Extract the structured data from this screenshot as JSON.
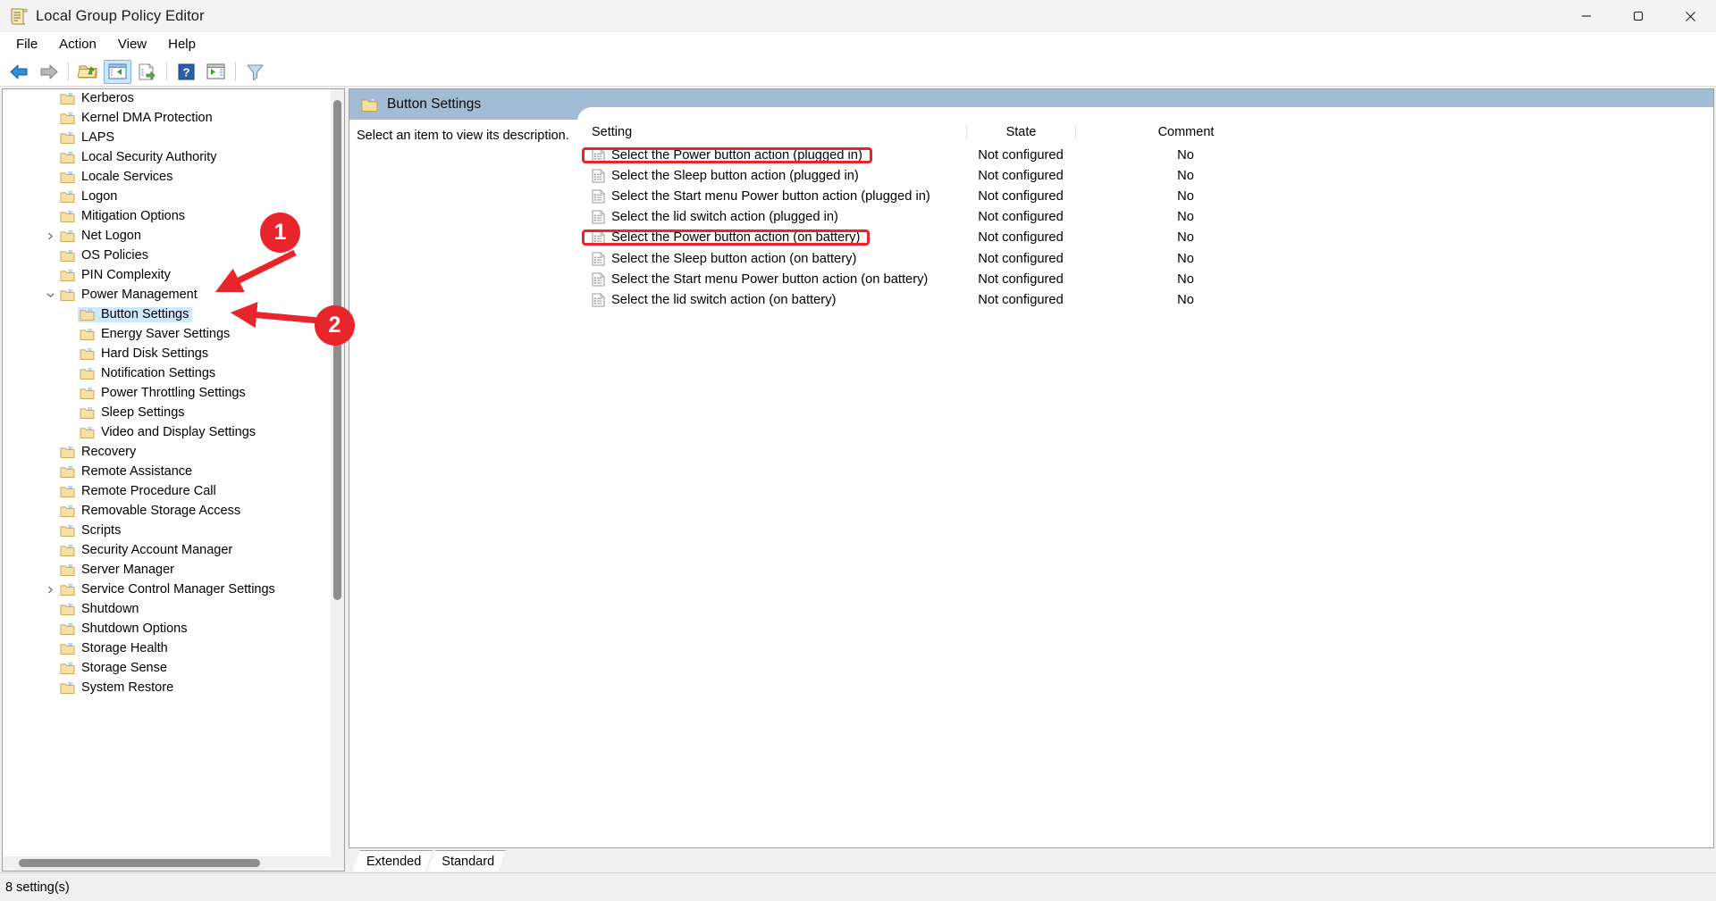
{
  "window": {
    "title": "Local Group Policy Editor",
    "icon": "group-policy-document-icon",
    "minimize": "—",
    "maximize": "❐",
    "close": "✕"
  },
  "menubar": {
    "items": [
      {
        "label": "File"
      },
      {
        "label": "Action"
      },
      {
        "label": "View"
      },
      {
        "label": "Help"
      }
    ]
  },
  "toolbar": {
    "buttons": [
      {
        "name": "back-icon",
        "title": "Back"
      },
      {
        "name": "forward-icon",
        "title": "Forward"
      },
      {
        "name": "up-one-level-folder-icon",
        "title": "Up One Level"
      },
      {
        "name": "show-hide-console-tree-icon",
        "title": "Show/Hide Console Tree",
        "active": true
      },
      {
        "name": "export-list-icon",
        "title": "Export List"
      },
      {
        "name": "help-icon",
        "title": "Help"
      },
      {
        "name": "show-hide-action-pane-icon",
        "title": "Show/Hide Action Pane"
      },
      {
        "name": "filter-icon",
        "title": "Filter"
      }
    ]
  },
  "tree": {
    "items": [
      {
        "label": "Kerberos",
        "indent": 1,
        "expander": "none",
        "selected": false
      },
      {
        "label": "Kernel DMA Protection",
        "indent": 1,
        "expander": "none",
        "selected": false
      },
      {
        "label": "LAPS",
        "indent": 1,
        "expander": "none",
        "selected": false
      },
      {
        "label": "Local Security Authority",
        "indent": 1,
        "expander": "none",
        "selected": false
      },
      {
        "label": "Locale Services",
        "indent": 1,
        "expander": "none",
        "selected": false
      },
      {
        "label": "Logon",
        "indent": 1,
        "expander": "none",
        "selected": false
      },
      {
        "label": "Mitigation Options",
        "indent": 1,
        "expander": "none",
        "selected": false
      },
      {
        "label": "Net Logon",
        "indent": 1,
        "expander": "collapsed",
        "selected": false
      },
      {
        "label": "OS Policies",
        "indent": 1,
        "expander": "none",
        "selected": false
      },
      {
        "label": "PIN Complexity",
        "indent": 1,
        "expander": "none",
        "selected": false
      },
      {
        "label": "Power Management",
        "indent": 1,
        "expander": "expanded",
        "selected": false
      },
      {
        "label": "Button Settings",
        "indent": 2,
        "expander": "none",
        "selected": true
      },
      {
        "label": "Energy Saver Settings",
        "indent": 2,
        "expander": "none",
        "selected": false
      },
      {
        "label": "Hard Disk Settings",
        "indent": 2,
        "expander": "none",
        "selected": false
      },
      {
        "label": "Notification Settings",
        "indent": 2,
        "expander": "none",
        "selected": false
      },
      {
        "label": "Power Throttling Settings",
        "indent": 2,
        "expander": "none",
        "selected": false
      },
      {
        "label": "Sleep Settings",
        "indent": 2,
        "expander": "none",
        "selected": false
      },
      {
        "label": "Video and Display Settings",
        "indent": 2,
        "expander": "none",
        "selected": false
      },
      {
        "label": "Recovery",
        "indent": 1,
        "expander": "none",
        "selected": false
      },
      {
        "label": "Remote Assistance",
        "indent": 1,
        "expander": "none",
        "selected": false
      },
      {
        "label": "Remote Procedure Call",
        "indent": 1,
        "expander": "none",
        "selected": false
      },
      {
        "label": "Removable Storage Access",
        "indent": 1,
        "expander": "none",
        "selected": false
      },
      {
        "label": "Scripts",
        "indent": 1,
        "expander": "none",
        "selected": false
      },
      {
        "label": "Security Account Manager",
        "indent": 1,
        "expander": "none",
        "selected": false
      },
      {
        "label": "Server Manager",
        "indent": 1,
        "expander": "none",
        "selected": false
      },
      {
        "label": "Service Control Manager Settings",
        "indent": 1,
        "expander": "collapsed",
        "selected": false
      },
      {
        "label": "Shutdown",
        "indent": 1,
        "expander": "none",
        "selected": false
      },
      {
        "label": "Shutdown Options",
        "indent": 1,
        "expander": "none",
        "selected": false
      },
      {
        "label": "Storage Health",
        "indent": 1,
        "expander": "none",
        "selected": false
      },
      {
        "label": "Storage Sense",
        "indent": 1,
        "expander": "none",
        "selected": false
      },
      {
        "label": "System Restore",
        "indent": 1,
        "expander": "none",
        "selected": false
      }
    ]
  },
  "pane": {
    "header_title": "Button Settings",
    "header_color": "#a3bcd6",
    "description_placeholder": "Select an item to view its description.",
    "columns": {
      "setting": "Setting",
      "state": "State",
      "comment": "Comment"
    },
    "rows": [
      {
        "setting": "Select the Power button action (plugged in)",
        "state": "Not configured",
        "comment": "No",
        "highlighted": true
      },
      {
        "setting": "Select the Sleep button action (plugged in)",
        "state": "Not configured",
        "comment": "No",
        "highlighted": false
      },
      {
        "setting": "Select the Start menu Power button action (plugged in)",
        "state": "Not configured",
        "comment": "No",
        "highlighted": false
      },
      {
        "setting": "Select the lid switch action (plugged in)",
        "state": "Not configured",
        "comment": "No",
        "highlighted": false
      },
      {
        "setting": "Select the Power button action (on battery)",
        "state": "Not configured",
        "comment": "No",
        "highlighted": true
      },
      {
        "setting": "Select the Sleep button action (on battery)",
        "state": "Not configured",
        "comment": "No",
        "highlighted": false
      },
      {
        "setting": "Select the Start menu Power button action (on battery)",
        "state": "Not configured",
        "comment": "No",
        "highlighted": false
      },
      {
        "setting": "Select the lid switch action (on battery)",
        "state": "Not configured",
        "comment": "No",
        "highlighted": false
      }
    ]
  },
  "tabs": [
    {
      "label": "Extended",
      "active": false
    },
    {
      "label": "Standard",
      "active": true
    }
  ],
  "statusbar": {
    "text": "8 setting(s)"
  },
  "annotations": {
    "accent_color": "#e8252a",
    "markers": [
      {
        "number": "1",
        "target": "power-management-tree-item"
      },
      {
        "number": "2",
        "target": "button-settings-tree-item"
      }
    ]
  }
}
